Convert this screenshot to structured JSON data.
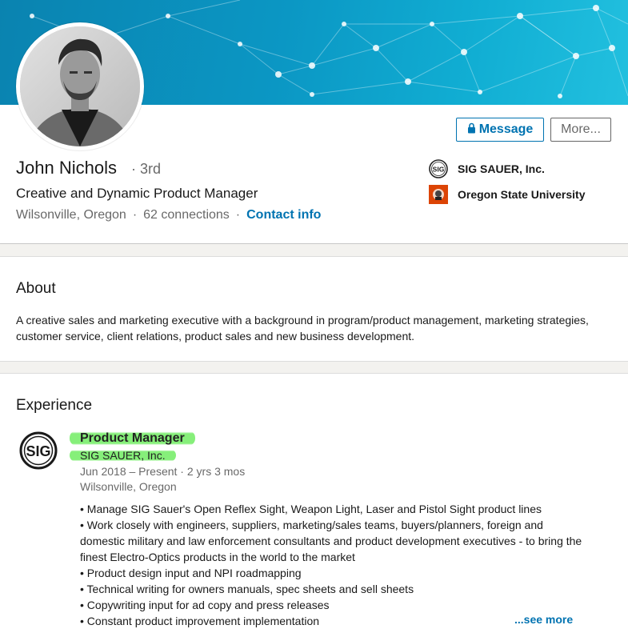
{
  "profile": {
    "name": "John Nichols",
    "degree_separator": "·",
    "degree": "3rd",
    "headline": "Creative and Dynamic Product Manager",
    "location": "Wilsonville, Oregon",
    "separator": "·",
    "connections": "62 connections",
    "contact_label": "Contact info",
    "actions": {
      "message_label": "Message",
      "more_label": "More..."
    },
    "orgs": [
      {
        "name": "SIG SAUER, Inc.",
        "icon": "sig-sauer-logo"
      },
      {
        "name": "Oregon State University",
        "icon": "osu-logo"
      }
    ]
  },
  "about": {
    "title": "About",
    "text": "A creative sales and marketing executive with a background in program/product management, marketing strategies, customer service, client relations, product sales and new business development."
  },
  "experience": {
    "title": "Experience",
    "items": [
      {
        "title": "Product Manager",
        "company": "SIG SAUER, Inc.",
        "dates": "Jun 2018 – Present · 2 yrs 3 mos",
        "location": "Wilsonville, Oregon",
        "bullets": [
          "• Manage SIG Sauer's Open Reflex Sight, Weapon Light, Laser and Pistol Sight product lines",
          "• Work closely with engineers, suppliers, marketing/sales teams, buyers/planners, foreign and domestic military and law enforcement consultants and product development executives - to bring the finest Electro-Optics products in the world to the market",
          "• Product design input and NPI roadmapping",
          "• Technical writing for owners manuals, spec sheets and sell sheets",
          "• Copywriting input for ad copy and press releases",
          "• Constant product improvement implementation"
        ],
        "see_more_label": "...see more"
      }
    ]
  },
  "colors": {
    "brand_blue": "#0073b1",
    "highlight_green": "#86ef7a",
    "banner_blue": "#0b97c4"
  }
}
